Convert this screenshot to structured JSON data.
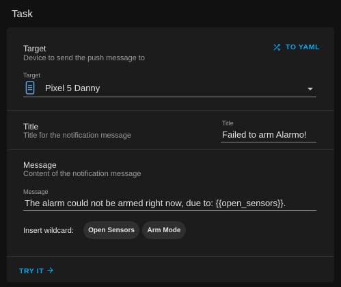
{
  "header": {
    "title": "Task"
  },
  "actions": {
    "yaml_label": "TO YAML",
    "try_label": "TRY IT"
  },
  "target": {
    "label": "Target",
    "description": "Device to send the push message to",
    "field_label": "Target",
    "value": "Pixel 5 Danny",
    "icon": "phone-icon"
  },
  "title_row": {
    "label": "Title",
    "description": "Title for the notification message",
    "field_label": "Title",
    "value": "Failed to arm Alarmo!"
  },
  "message_row": {
    "label": "Message",
    "description": "Content of the notification message",
    "field_label": "Message",
    "value": "The alarm could not be armed right now, due to: {{open_sensors}}."
  },
  "wildcards": {
    "label": "Insert wildcard:",
    "options": [
      "Open Sensors",
      "Arm Mode"
    ]
  },
  "colors": {
    "accent": "#03a9f4",
    "card": "#1c1c1c",
    "background": "#111111"
  }
}
